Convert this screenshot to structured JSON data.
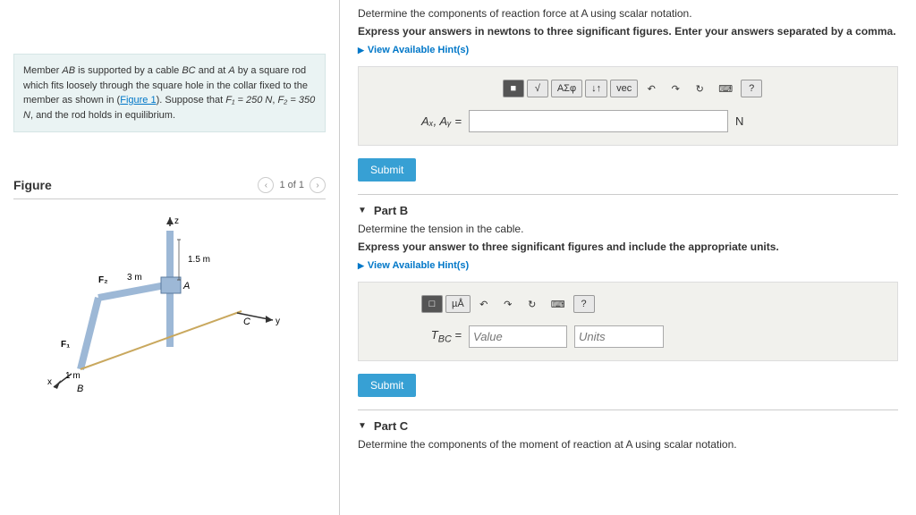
{
  "problem": {
    "text_1": "Member ",
    "ab": "AB",
    "text_2": " is supported by a cable ",
    "bc": "BC",
    "text_3": " and at ",
    "a": "A",
    "text_4": " by a square rod which fits loosely through the square hole in the collar fixed to the member as shown in (",
    "figure_link": "Figure 1",
    "text_5": "). Suppose that ",
    "f1": "F₁ = 250 N",
    "text_6": ", ",
    "f2": "F₂ = 350 N",
    "text_7": ", and the rod holds in equilibrium."
  },
  "figure": {
    "title": "Figure",
    "pager": "1 of 1",
    "labels": {
      "z": "z",
      "y": "y",
      "x": "x",
      "a": "A",
      "b": "B",
      "c": "C",
      "f1": "F₁",
      "f2": "F₂",
      "d1": "1.5 m",
      "d2": "3 m",
      "d3": "1 m"
    }
  },
  "partA": {
    "prompt": "Determine the components of reaction force at A using scalar notation.",
    "instruction": "Express your answers in newtons to three significant figures. Enter your answers separated by a comma.",
    "hints": "View Available Hint(s)",
    "label": "Aₓ, Aᵧ =",
    "unit": "N",
    "submit": "Submit",
    "tools": {
      "t1": "√",
      "t2": "ΑΣφ",
      "t3": "↓↑",
      "t4": "vec",
      "t5": "↶",
      "t6": "↷",
      "t7": "↻",
      "t8": "⌨",
      "t9": "?"
    }
  },
  "partB": {
    "title": "Part B",
    "prompt": "Determine the tension in the cable.",
    "instruction": "Express your answer to three significant figures and include the appropriate units.",
    "hints": "View Available Hint(s)",
    "label": "T_BC =",
    "value_ph": "Value",
    "units_ph": "Units",
    "submit": "Submit",
    "tools": {
      "t1": "□",
      "t2": "µÅ",
      "t3": "↶",
      "t4": "↷",
      "t5": "↻",
      "t6": "⌨",
      "t7": "?"
    }
  },
  "partC": {
    "title": "Part C",
    "prompt": "Determine the components of the moment of reaction at A using scalar notation."
  }
}
